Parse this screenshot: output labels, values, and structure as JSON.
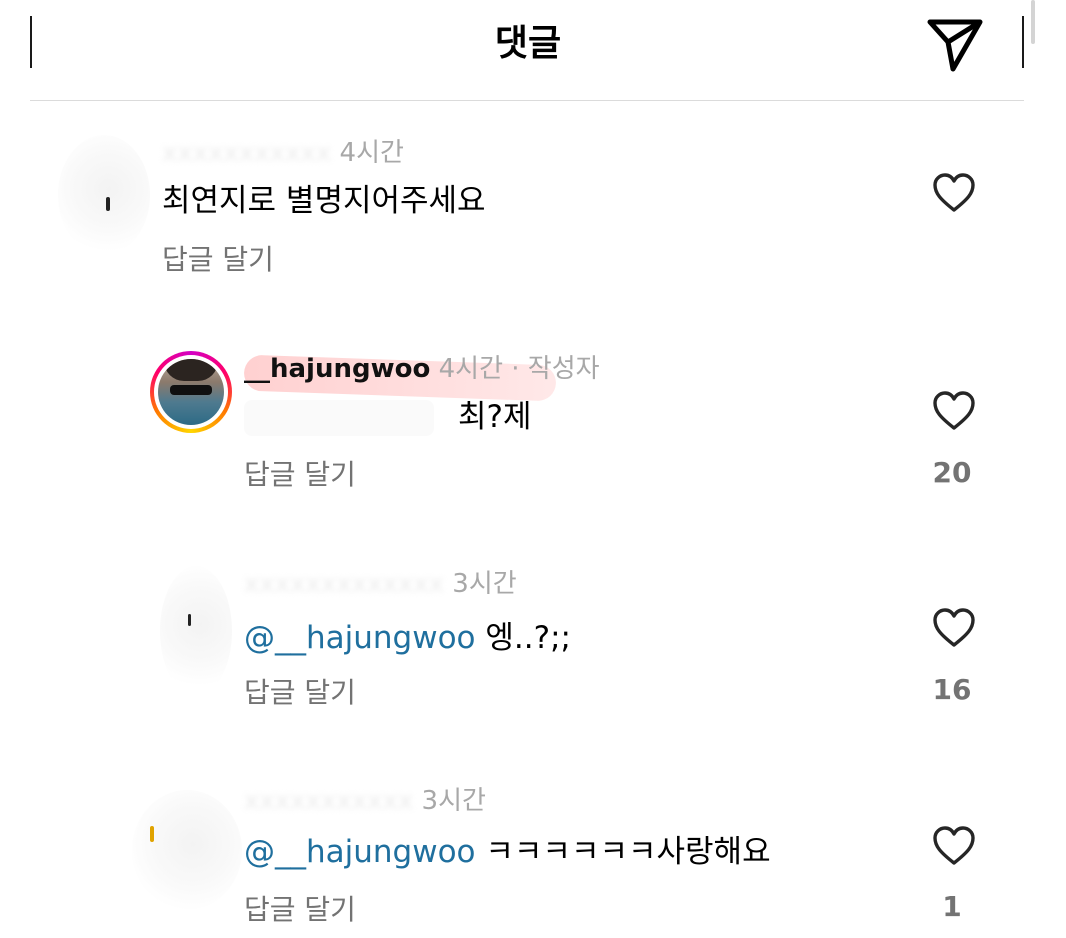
{
  "header": {
    "title": "댓글",
    "send_icon": "paper-plane-icon"
  },
  "comments": [
    {
      "username": "",
      "time": "4시간",
      "text": "최연지로 별명지어주세요",
      "reply_label": "답글 달기",
      "likes": ""
    },
    {
      "username": "__hajungwoo",
      "time": "4시간",
      "author_tag": "· 작성자",
      "text": "최?제",
      "reply_label": "답글 달기",
      "likes": "20"
    },
    {
      "username": "",
      "time": "3시간",
      "mention": "@__hajungwoo",
      "text": "엥..?;;",
      "reply_label": "답글 달기",
      "likes": "16"
    },
    {
      "username": "",
      "time": "3시간",
      "mention": "@__hajungwoo",
      "text": "ㅋㅋㅋㅋㅋㅋ사랑해요",
      "reply_label": "답글 달기",
      "likes": "1"
    }
  ],
  "icons": {
    "like": "heart-outline-icon"
  }
}
